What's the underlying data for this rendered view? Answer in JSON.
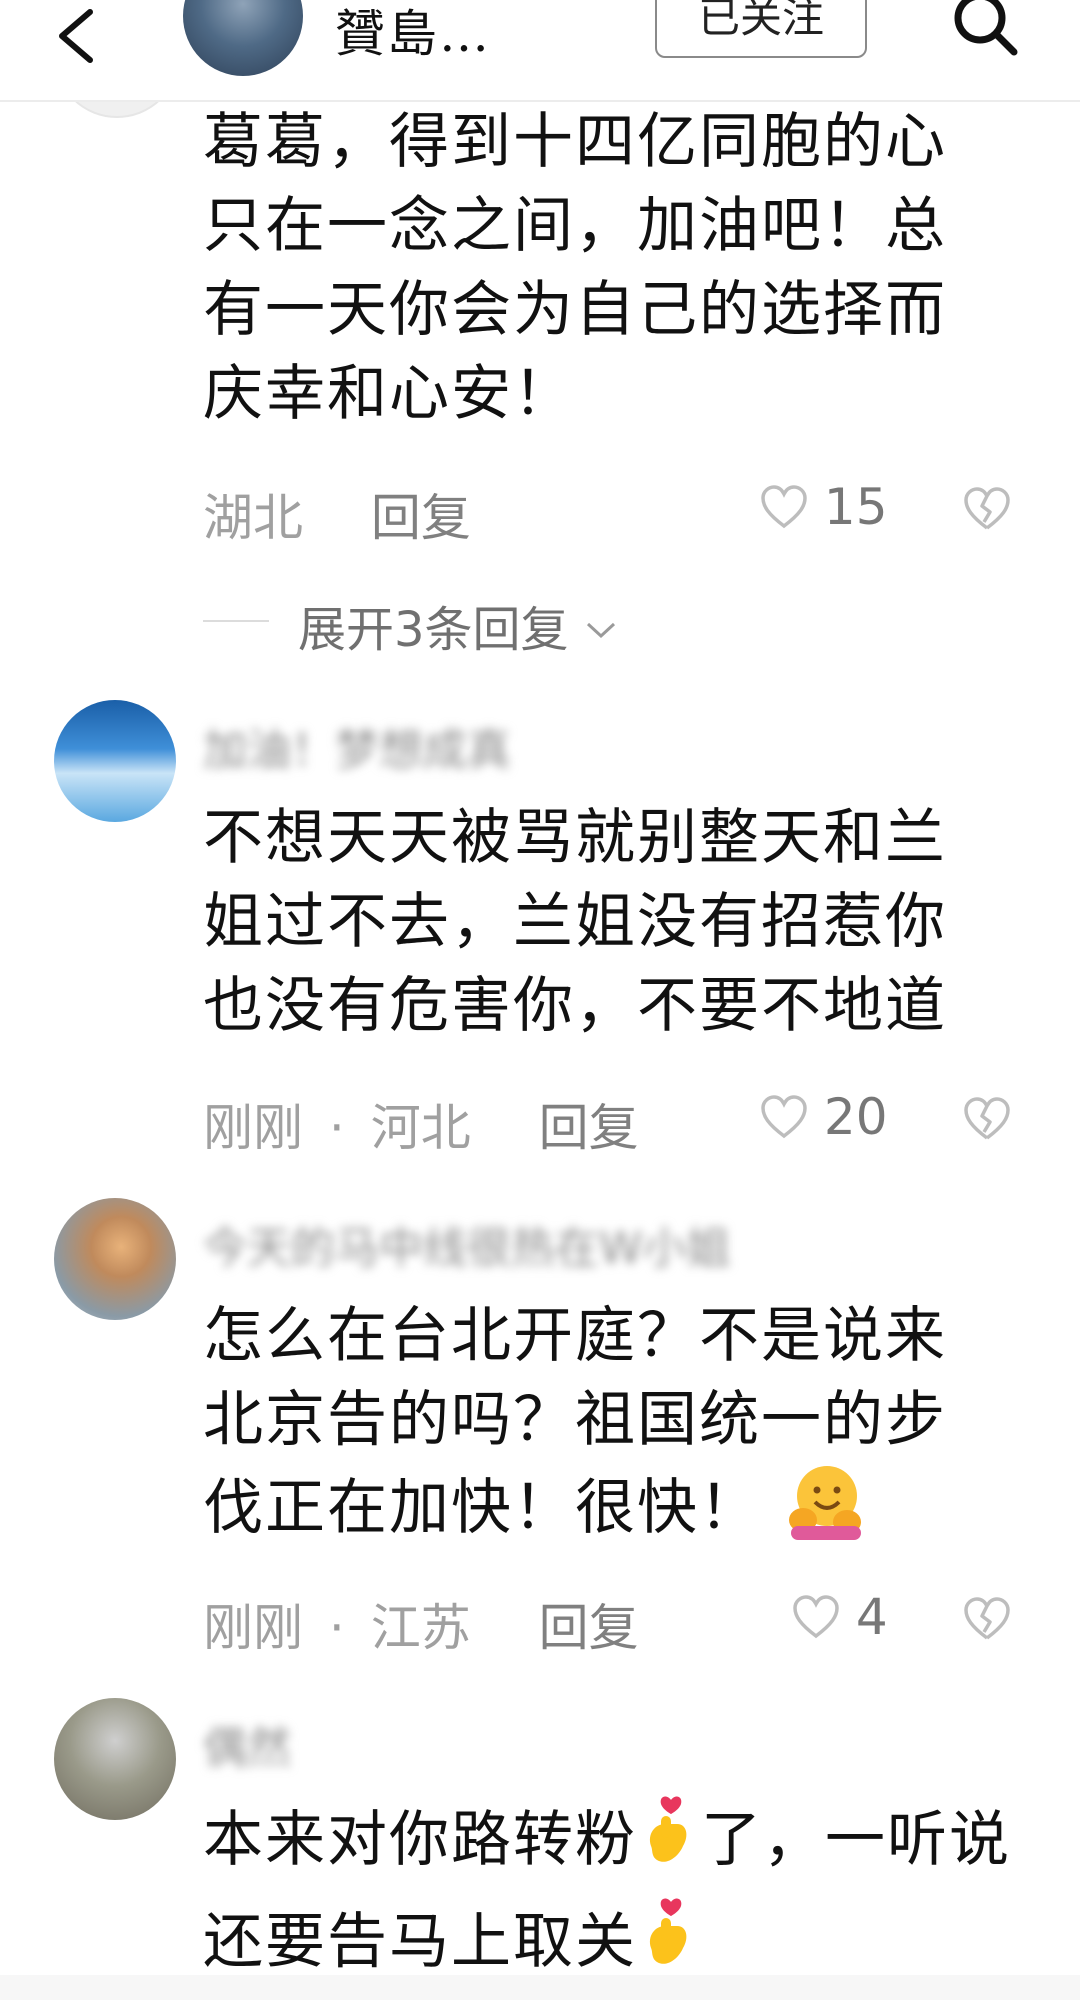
{
  "header": {
    "back_icon": "chevron-left-icon",
    "title": "贇島…",
    "follow_label": "已关注",
    "search_icon": "search-icon"
  },
  "comments": [
    {
      "content": "葛葛，得到十四亿同胞的心只在一念之间，加油吧！总有一天你会为自己的选择而庆幸和心安！",
      "location": "湖北",
      "reply_label": "回复",
      "likes": "15",
      "expand_label": "展开3条回复"
    },
    {
      "username": "加油！梦想成真",
      "content": "不想天天被骂就别整天和兰姐过不去，兰姐没有招惹你也没有危害你，不要不地道",
      "time": "刚刚",
      "location": "河北",
      "reply_label": "回复",
      "likes": "20"
    },
    {
      "username": "今天的马中线很热在W小姐",
      "content": "怎么在台北开庭？不是说来北京告的吗？祖国统一的步伐正在加快！很快！",
      "time": "刚刚",
      "location": "江苏",
      "reply_label": "回复",
      "likes": "4"
    },
    {
      "username": "偶然",
      "content_a": "本来对你路转粉",
      "content_b": "了，一听说还要告马上取关"
    }
  ],
  "separator": "·",
  "colors": {
    "text": "#111111",
    "meta": "#a0a0a0",
    "heart": "#c8c8c8"
  }
}
